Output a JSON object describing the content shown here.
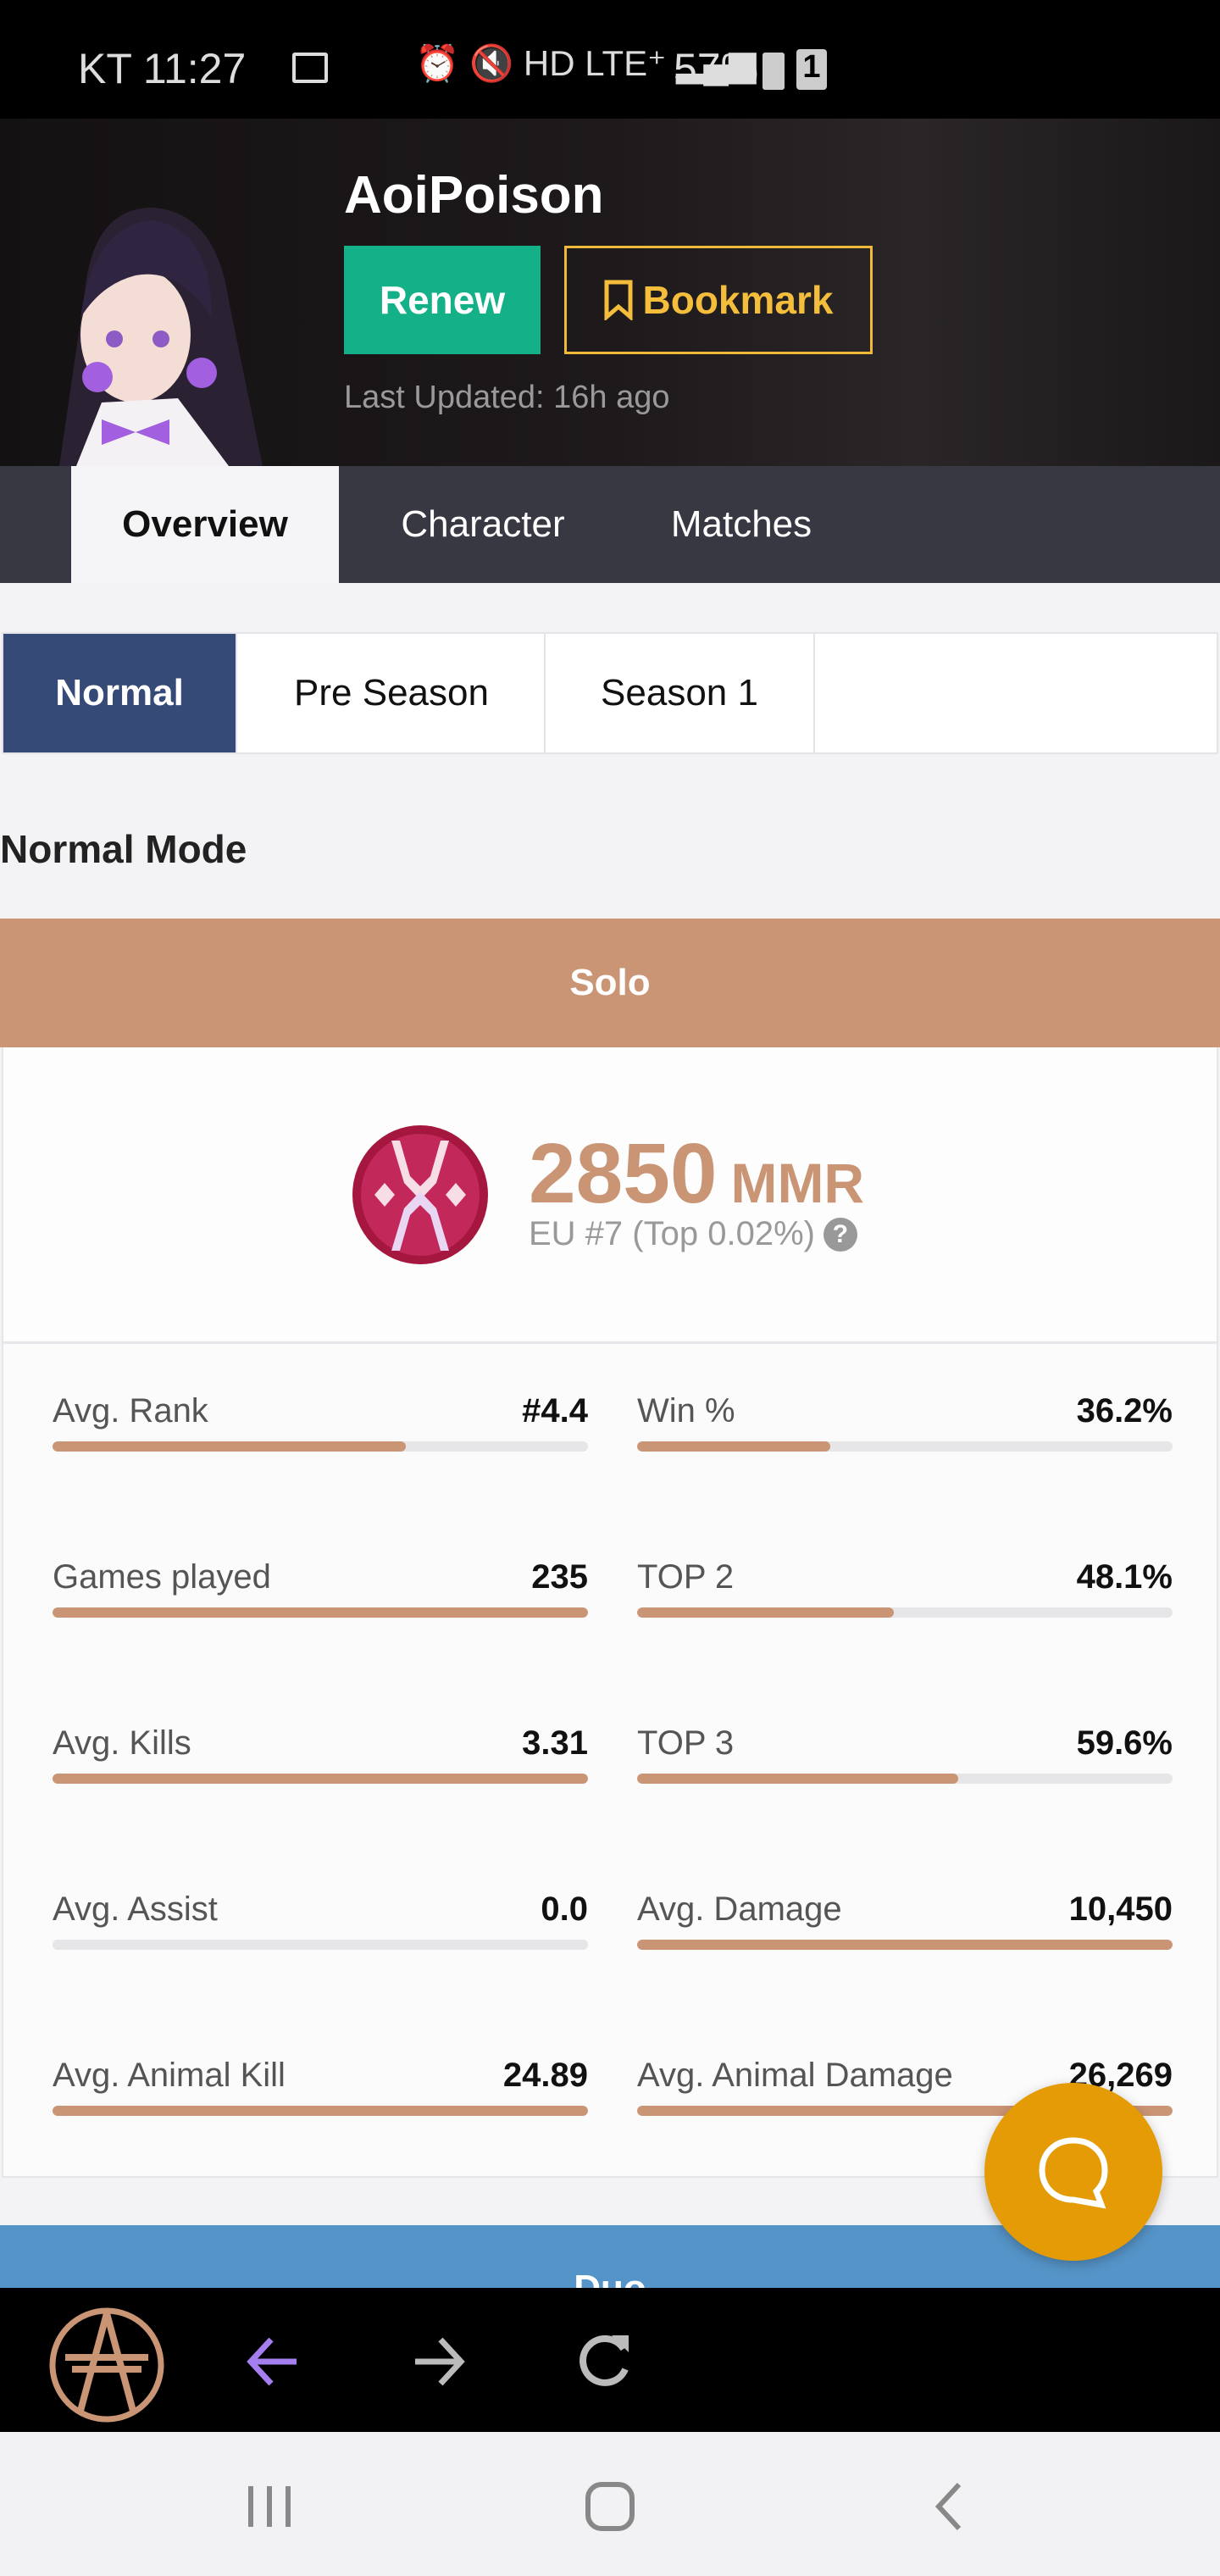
{
  "status_bar": {
    "carrier_time": "KT 11:27",
    "battery": "57%",
    "sim": "1"
  },
  "profile": {
    "name": "AoiPoison",
    "renew_label": "Renew",
    "bookmark_label": "Bookmark",
    "last_updated": "Last Updated: 16h ago"
  },
  "tabs": [
    {
      "label": "Overview",
      "active": true
    },
    {
      "label": "Character"
    },
    {
      "label": "Matches"
    }
  ],
  "season_tabs": [
    {
      "label": "Normal",
      "active": true
    },
    {
      "label": "Pre Season"
    },
    {
      "label": "Season 1"
    }
  ],
  "mode_title": "Normal Mode",
  "solo": {
    "header": "Solo",
    "mmr": "2850",
    "mmr_unit": "MMR",
    "region_rank": "EU #7 (Top 0.02%)",
    "stats": [
      {
        "label": "Avg. Rank",
        "value": "#4.4",
        "fill": 0.66
      },
      {
        "label": "Win %",
        "value": "36.2%",
        "fill": 0.36
      },
      {
        "label": "Games played",
        "value": "235",
        "fill": 1.0
      },
      {
        "label": "TOP 2",
        "value": "48.1%",
        "fill": 0.48
      },
      {
        "label": "Avg. Kills",
        "value": "3.31",
        "fill": 1.0
      },
      {
        "label": "TOP 3",
        "value": "59.6%",
        "fill": 0.6
      },
      {
        "label": "Avg. Assist",
        "value": "0.0",
        "fill": 0.0
      },
      {
        "label": "Avg. Damage",
        "value": "10,450",
        "fill": 1.0
      },
      {
        "label": "Avg. Animal Kill",
        "value": "24.89",
        "fill": 1.0
      },
      {
        "label": "Avg. Animal Damage",
        "value": "26,269",
        "fill": 1.0
      }
    ]
  },
  "duo": {
    "header": "Duo"
  },
  "colors": {
    "accent": "#c99574",
    "renew": "#14b088",
    "bookmark": "#f0b93a",
    "active_mode": "#354a76",
    "duo": "#5594c8",
    "fab": "#e49b06"
  }
}
